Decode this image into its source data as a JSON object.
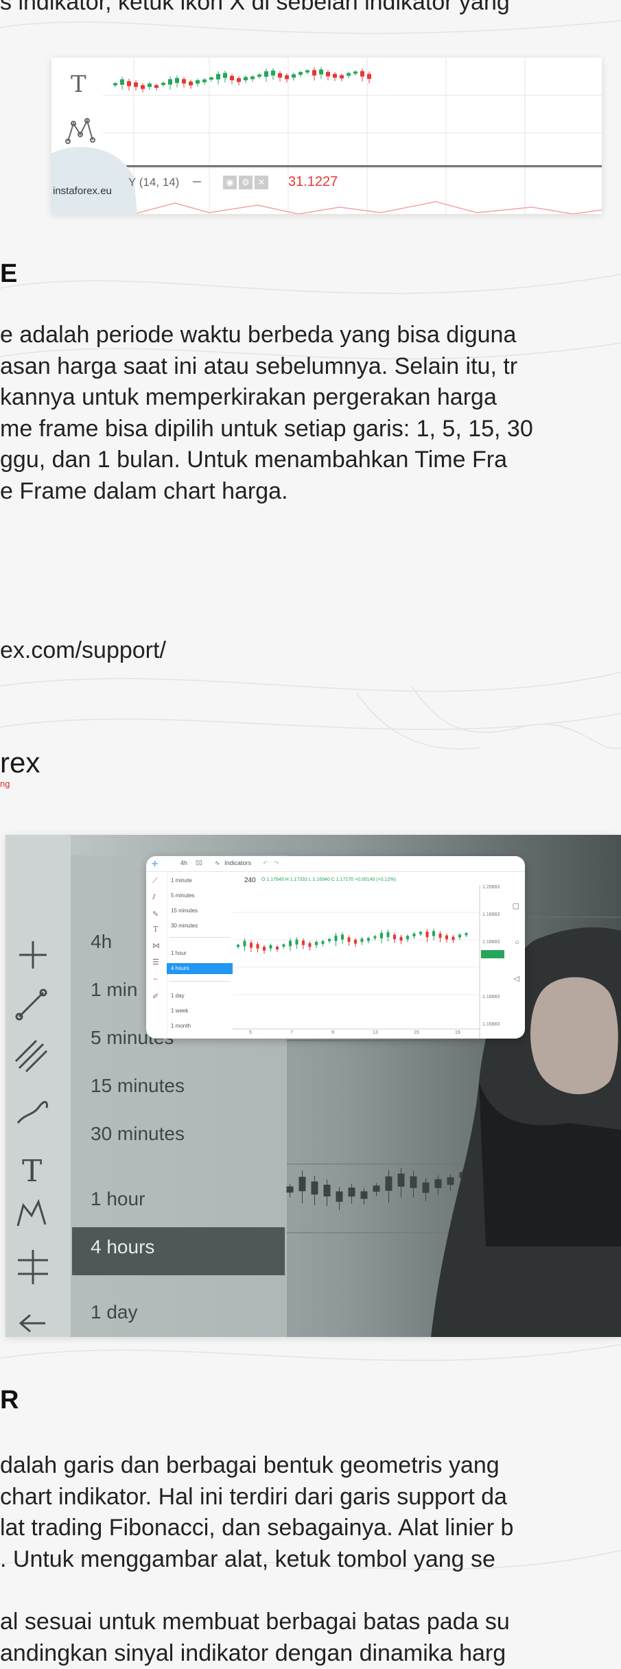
{
  "top_text": "s indikator, ketuk ikon X di sebelah indikator yang",
  "figure1": {
    "watermark": "instaforex.eu",
    "indicator_label": "Y (14, 14)",
    "indicator_value": "31.1227",
    "value_color": "#e53935"
  },
  "section_timeframe": {
    "heading": "E",
    "lines": [
      "e adalah periode waktu berbeda yang bisa diguna",
      "asan harga saat ini atau sebelumnya. Selain itu, tr",
      "kannya untuk memperkirakan pergerakan harga",
      "me frame bisa dipilih untuk setiap garis: 1, 5, 15, 30",
      "ggu, dan 1 bulan. Untuk menambahkan Time Fra",
      "e Frame dalam chart harga."
    ]
  },
  "support_link": "ex.com/support/",
  "logo": {
    "text": "rex",
    "tagline": "ng"
  },
  "figure2": {
    "left_tools_large": [
      "4h",
      "1 min",
      "5 minutes",
      "15 minutes",
      "30 minutes",
      "1 hour",
      "4 hours",
      "1 day"
    ],
    "inset": {
      "toolbar_interval": "4h",
      "toolbar_indicators": "Indicators",
      "menu": [
        "1 minute",
        "5 minutes",
        "15 minutes",
        "30 minutes",
        "1 hour",
        "4 hours",
        "1 day",
        "1 week",
        "1 month"
      ],
      "selected": "4 hours",
      "chart_interval": "240",
      "ohlc": "O 1.17649  H 1.17333  L 1.16940  C 1.17170  +0.00140 (+0.12%)",
      "price_ticks": [
        "1.20883",
        "1.18883",
        "1.18883",
        "1.17170",
        "1.16883",
        "1.16883"
      ],
      "x_ticks": [
        "5",
        "7",
        "9",
        "13",
        "15",
        "19"
      ]
    },
    "accent": "#2196f3",
    "up_color": "#26a65b",
    "down_color": "#e53935"
  },
  "section_drawing": {
    "heading": "R",
    "lines": [
      "dalah garis dan berbagai bentuk geometris yang",
      "chart indikator. Hal ini terdiri dari garis support da",
      "lat trading Fibonacci, dan sebagainya. Alat linier b",
      ". Untuk menggambar alat, ketuk tombol yang se"
    ],
    "lines2": [
      "al sesuai untuk membuat berbagai batas pada su",
      "andingkan sinyal indikator dengan dinamika harg"
    ]
  }
}
